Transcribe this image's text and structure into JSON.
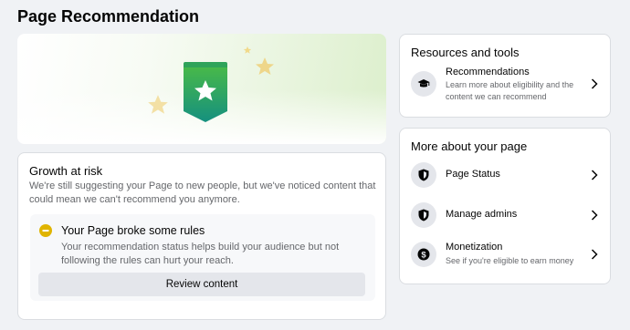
{
  "page": {
    "title": "Page Recommendation"
  },
  "growth": {
    "title": "Growth at risk",
    "description": "We're still suggesting your Page to new people, but we've noticed content that could mean we can't recommend you anymore.",
    "warning": {
      "icon": "minus-circle-icon",
      "title": "Your Page broke some rules",
      "description": "Your recommendation status helps build your audience but not following the rules can hurt your reach.",
      "button_label": "Review content"
    }
  },
  "resources": {
    "title": "Resources and tools",
    "items": [
      {
        "label": "Recommendations",
        "sublabel": "Learn more about eligibility and the content we can recommend",
        "icon": "graduation-cap-icon"
      }
    ]
  },
  "more": {
    "title": "More about your page",
    "items": [
      {
        "label": "Page Status",
        "icon": "shield-icon"
      },
      {
        "label": "Manage admins",
        "icon": "shield-icon"
      },
      {
        "label": "Monetization",
        "sublabel": "See if you're eligible to earn money",
        "icon": "dollar-circle-icon"
      }
    ]
  },
  "colors": {
    "accent_warning": "#e0b400",
    "badge_top": "#42b72a",
    "badge_bottom": "#1a8f7d",
    "star": "#f1d98a"
  }
}
